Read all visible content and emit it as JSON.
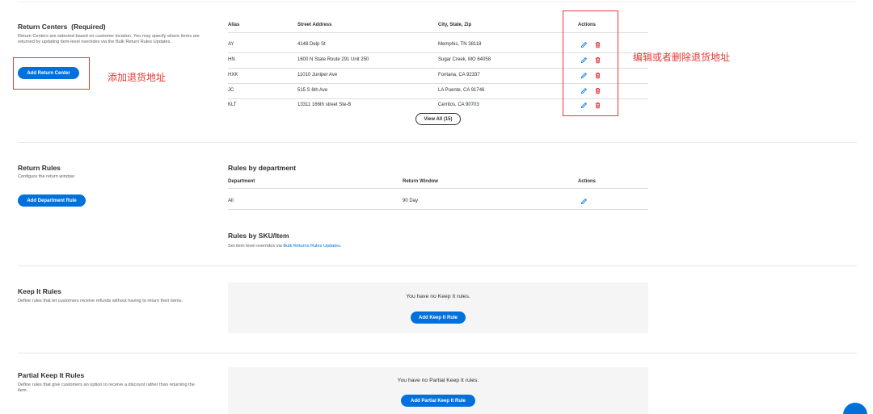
{
  "return_centers": {
    "title": "Return Centers  (Required)",
    "description": "Return Centers are selected based on customer location. You may specify where items are returned by updating item-level overrides via the Bulk Return Rules Updates.",
    "add_button": "Add Return Center",
    "columns": [
      "Alias",
      "Street Address",
      "City, State, Zip",
      "Actions"
    ],
    "rows": [
      {
        "alias": "AY",
        "street": "4148 Delp St",
        "city": "Memphis, TN 38118"
      },
      {
        "alias": "HN",
        "street": "1600 N State Route 291 Unit 250",
        "city": "Sugar Creek, MO 64058"
      },
      {
        "alias": "HXK",
        "street": "11010 Juniper Ave",
        "city": "Fontana, CA 92337"
      },
      {
        "alias": "JC",
        "street": "515 S 6th Ave",
        "city": "LA Puente, CA 91746"
      },
      {
        "alias": "KLT",
        "street": "13311 166th street Ste-B",
        "city": "Cerritos, CA 90703"
      }
    ],
    "view_all": "View All (15)"
  },
  "annotations": {
    "add_note": "添加退货地址",
    "edit_note": "编辑或者删除退货地址"
  },
  "return_rules": {
    "title": "Return Rules",
    "description": "Configure the return window",
    "add_button": "Add Department Rule",
    "dept_title": "Rules by department",
    "columns": [
      "Department",
      "Return Window",
      "Actions"
    ],
    "rows": [
      {
        "department": "All",
        "window": "90 Day"
      }
    ],
    "sku_title": "Rules by SKU/Item",
    "sku_desc_prefix": "Set item level overrides via ",
    "sku_link": "Bulk Returns Rules Updates",
    "sku_desc_suffix": "."
  },
  "keep_it": {
    "title": "Keep It Rules",
    "description": "Define rules that let customers receive refunds without having to return their items.",
    "empty": "You have no Keep It rules.",
    "add_button": "Add Keep It Rule"
  },
  "partial_keep_it": {
    "title": "Partial Keep It Rules",
    "description": "Define rules that give customers an option to receive a discount rather than returning the item.",
    "empty": "You have no Partial Keep It rules.",
    "add_button": "Add Partial Keep It Rule"
  },
  "colors": {
    "accent": "#0071dc",
    "danger": "#de1c24",
    "annotation": "#e53935"
  },
  "icons": {
    "edit": "pencil-icon",
    "delete": "trash-icon",
    "badge": "spark-icon"
  }
}
